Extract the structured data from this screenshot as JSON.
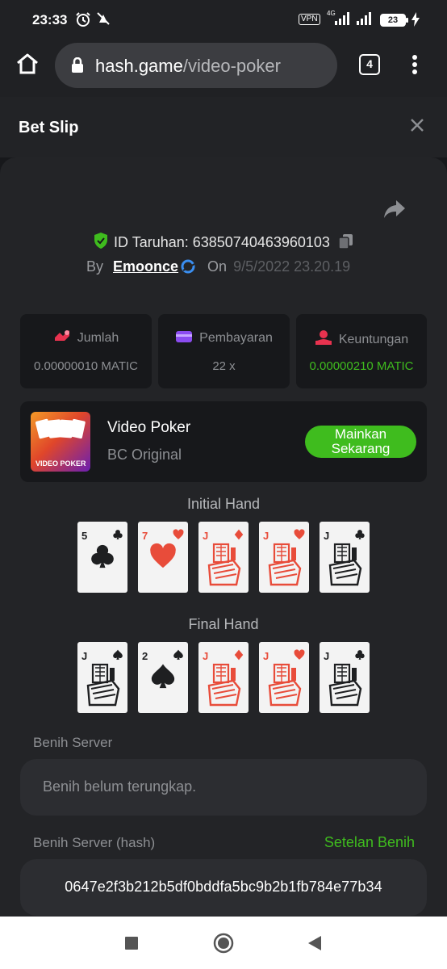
{
  "status_bar": {
    "time": "23:33",
    "vpn": "VPN",
    "network": "4G",
    "battery": "23",
    "icons": [
      "alarm-icon",
      "notification-icon",
      "signal-icon",
      "wifi-signal-icon",
      "charging-icon"
    ]
  },
  "browser": {
    "url_host": "hash.game",
    "url_path": "/video-poker",
    "tab_count": "4",
    "icons": [
      "home-icon",
      "lock-icon",
      "menu-icon"
    ]
  },
  "bet_slip": {
    "title": "Bet Slip",
    "bet_id": "ID Taruhan: 63850740463960103",
    "by_label": "By",
    "user": "Emoonce",
    "on_label": "On",
    "date": "9/5/2022 23.20.19"
  },
  "stats": [
    {
      "label": "Jumlah",
      "value": "0.00000010 MATIC",
      "icon": "amount-icon"
    },
    {
      "label": "Pembayaran",
      "value": "22 x",
      "icon": "payout-card-icon"
    },
    {
      "label": "Keuntungan",
      "value": "0.00000210 MATIC",
      "icon": "profit-icon"
    }
  ],
  "game": {
    "name": "Video Poker",
    "provider": "BC Original",
    "play_label": "Mainkan Sekarang",
    "thumb_text": "VIDEO POKER"
  },
  "initial_hand": {
    "title": "Initial Hand",
    "cards": [
      {
        "rank": "5",
        "suit": "clubs"
      },
      {
        "rank": "7",
        "suit": "hearts"
      },
      {
        "rank": "J",
        "suit": "diamonds"
      },
      {
        "rank": "J",
        "suit": "hearts"
      },
      {
        "rank": "J",
        "suit": "clubs"
      }
    ]
  },
  "final_hand": {
    "title": "Final Hand",
    "cards": [
      {
        "rank": "J",
        "suit": "spades"
      },
      {
        "rank": "2",
        "suit": "spades"
      },
      {
        "rank": "J",
        "suit": "diamonds"
      },
      {
        "rank": "J",
        "suit": "hearts"
      },
      {
        "rank": "J",
        "suit": "clubs"
      }
    ]
  },
  "server_seed": {
    "label": "Benih Server",
    "placeholder": "Benih belum terungkap."
  },
  "server_seed_hash": {
    "label": "Benih Server (hash)",
    "link": "Setelan Benih",
    "value": "0647e2f3b212b5df0bddfa5bc9b2b1fb784e77b34"
  },
  "colors": {
    "accent_green": "#3fbc1e",
    "background": "#17181b",
    "panel": "#232427"
  }
}
